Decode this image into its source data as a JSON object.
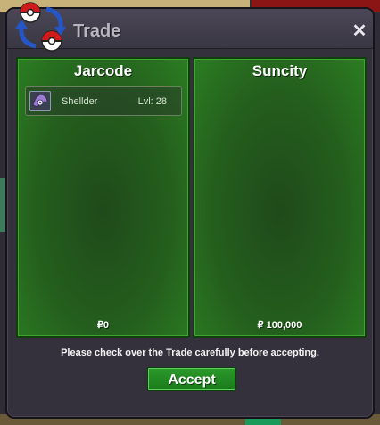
{
  "window": {
    "title": "Trade",
    "close_icon": "close-icon",
    "title_icon": "trade-swap-icon"
  },
  "panels": [
    {
      "name": "Jarcode",
      "money": "₽0",
      "items": [
        {
          "name": "Shellder",
          "level": "Lvl: 28",
          "icon": "shellder-sprite-icon"
        }
      ]
    },
    {
      "name": "Suncity",
      "money": "₽ 100,000",
      "items": []
    }
  ],
  "notice": "Please check over the Trade carefully before accepting.",
  "accept_label": "Accept",
  "colors": {
    "panel_green": "#245e1d",
    "accept_green": "#1b7a1b",
    "window_bg": "#34313c"
  }
}
